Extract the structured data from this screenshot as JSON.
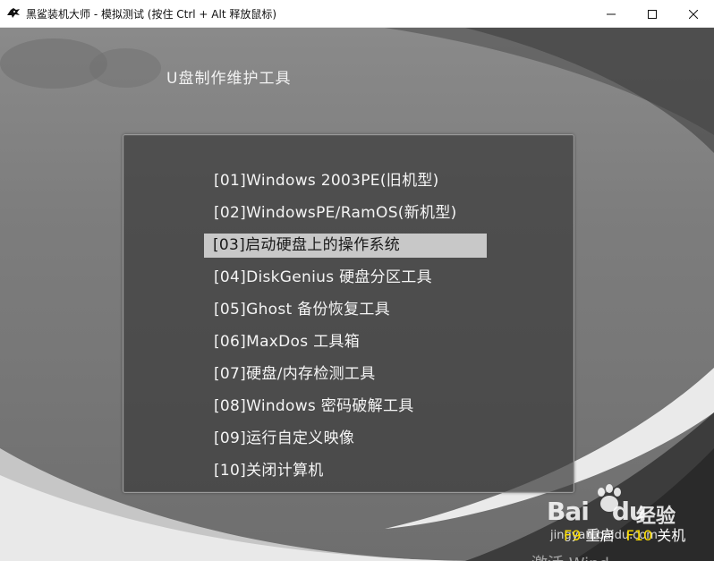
{
  "window": {
    "title": "黑鲨装机大师 - 模拟测试 (按住 Ctrl + Alt 释放鼠标)"
  },
  "icons": {
    "app": "black-shark-logo-icon",
    "minimize": "minimize-icon",
    "maximize": "maximize-icon",
    "close": "close-icon"
  },
  "screen": {
    "header_title": "U盘制作维护工具",
    "selected_index": 2,
    "selected_bg": "#c8c8c8",
    "menu_items": [
      {
        "label": "[01]Windows 2003PE(旧机型)"
      },
      {
        "label": "[02]WindowsPE/RamOS(新机型)"
      },
      {
        "label": "[03]启动硬盘上的操作系统"
      },
      {
        "label": "[04]DiskGenius 硬盘分区工具"
      },
      {
        "label": "[05]Ghost 备份恢复工具"
      },
      {
        "label": "[06]MaxDos 工具箱"
      },
      {
        "label": "[07]硬盘/内存检测工具"
      },
      {
        "label": "[08]Windows 密码破解工具"
      },
      {
        "label": "[09]运行自定义映像"
      },
      {
        "label": "[10]关闭计算机"
      }
    ],
    "footer": {
      "key1": "F9",
      "action1": "重启",
      "key2": "F10",
      "action2": "关机",
      "key_color": "#ffe000"
    },
    "activate_text": "激活 Wind"
  },
  "watermark": {
    "brand": "Bai",
    "brand2": "du",
    "product": "经验",
    "url": "jingyan.baidu.com"
  }
}
